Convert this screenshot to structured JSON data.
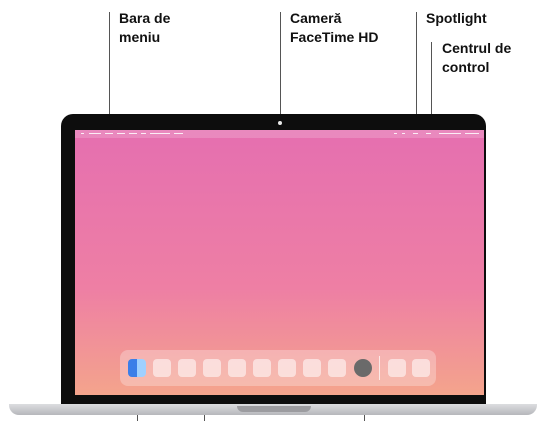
{
  "callouts": {
    "menu_bar": "Bara de\nmeniu",
    "camera": "Cameră\nFaceTime HD",
    "spotlight": "Spotlight",
    "control_center": "Centrul de\ncontrol"
  },
  "colors": {
    "screen_top": "#e56fb0",
    "screen_bottom": "#f4a48c",
    "frame": "#0d0d0d"
  },
  "icons": [
    "apple-icon",
    "search-icon",
    "control-center-icon",
    "finder-icon",
    "system-settings-icon"
  ]
}
